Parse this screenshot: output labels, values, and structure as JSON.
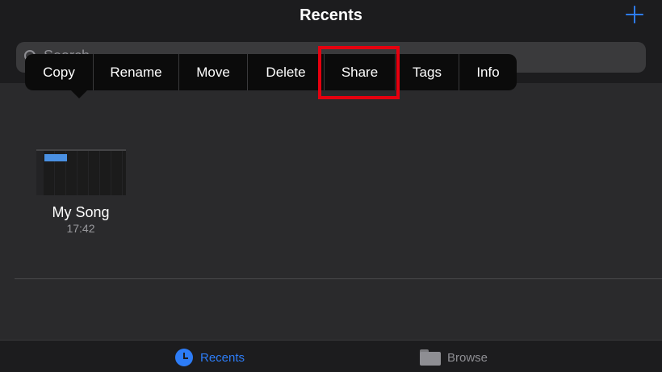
{
  "header": {
    "title": "Recents",
    "add_icon": "plus-icon",
    "accent_color": "#2d7cf6"
  },
  "search": {
    "placeholder": "Search",
    "value": ""
  },
  "context_menu": {
    "items": [
      {
        "label": "Copy"
      },
      {
        "label": "Rename"
      },
      {
        "label": "Move"
      },
      {
        "label": "Delete"
      },
      {
        "label": "Share",
        "highlighted": true
      },
      {
        "label": "Tags"
      },
      {
        "label": "Info"
      }
    ],
    "highlight_color": "#e5000f"
  },
  "files": [
    {
      "name": "My Song",
      "time": "17:42",
      "thumbnail_icon": "garageband-project-thumbnail"
    }
  ],
  "tab_bar": {
    "tabs": [
      {
        "label": "Recents",
        "icon": "clock-icon",
        "selected": true
      },
      {
        "label": "Browse",
        "icon": "folder-icon",
        "selected": false
      }
    ]
  }
}
